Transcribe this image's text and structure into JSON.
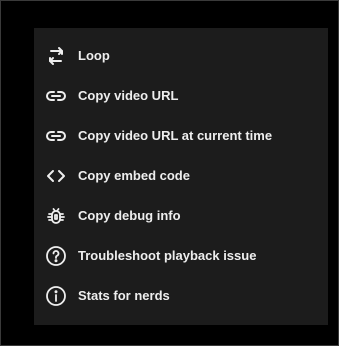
{
  "menu": {
    "items": [
      {
        "label": "Loop",
        "icon": "loop-icon"
      },
      {
        "label": "Copy video URL",
        "icon": "link-icon"
      },
      {
        "label": "Copy video URL at current time",
        "icon": "link-icon"
      },
      {
        "label": "Copy embed code",
        "icon": "code-icon"
      },
      {
        "label": "Copy debug info",
        "icon": "bug-icon"
      },
      {
        "label": "Troubleshoot playback issue",
        "icon": "help-circle-icon"
      },
      {
        "label": "Stats for nerds",
        "icon": "info-circle-icon"
      }
    ]
  },
  "colors": {
    "background": "#000000",
    "menu_background": "#1c1c1c",
    "text": "#eeeeee"
  }
}
